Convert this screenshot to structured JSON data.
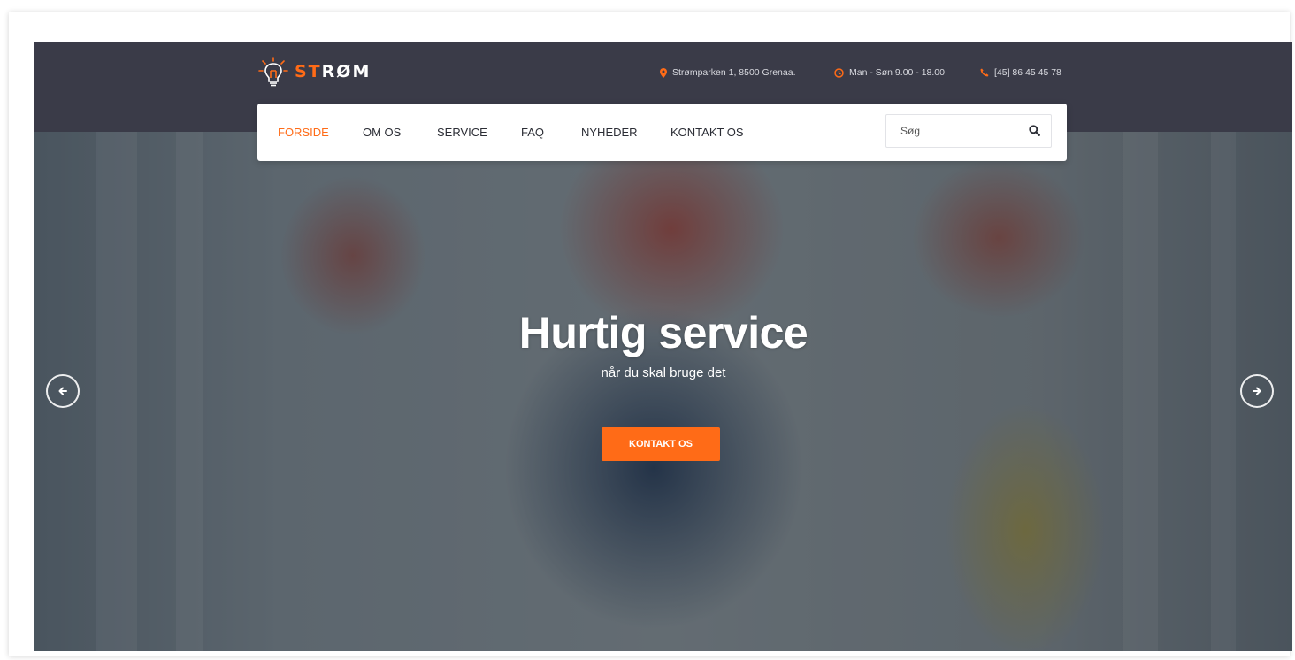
{
  "brand": {
    "name_prefix": "ST",
    "name_suffix": "RØM",
    "icon": "lightbulb-icon"
  },
  "contact": {
    "address": "Strømparken 1, 8500 Grenaa.",
    "hours": "Man - Søn 9.00 - 18.00",
    "phone": "[45] 86 45 45 78",
    "icons": [
      "map-pin-icon",
      "clock-icon",
      "phone-icon"
    ]
  },
  "nav": {
    "items": [
      {
        "label": "FORSIDE",
        "active": true
      },
      {
        "label": "OM OS",
        "active": false
      },
      {
        "label": "SERVICE",
        "active": false
      },
      {
        "label": "FAQ",
        "active": false
      },
      {
        "label": "NYHEDER",
        "active": false
      },
      {
        "label": "KONTAKT OS",
        "active": false
      }
    ],
    "search_placeholder": "Søg"
  },
  "hero": {
    "title": "Hurtig service",
    "subtitle": "når du skal bruge det",
    "button_label": "KONTAKT OS",
    "prev_icon": "arrow-left-icon",
    "next_icon": "arrow-right-icon"
  },
  "colors": {
    "accent": "#ff6b17",
    "topbar": "#3a3b48",
    "nav_text": "#2b2d35",
    "white": "#ffffff"
  }
}
